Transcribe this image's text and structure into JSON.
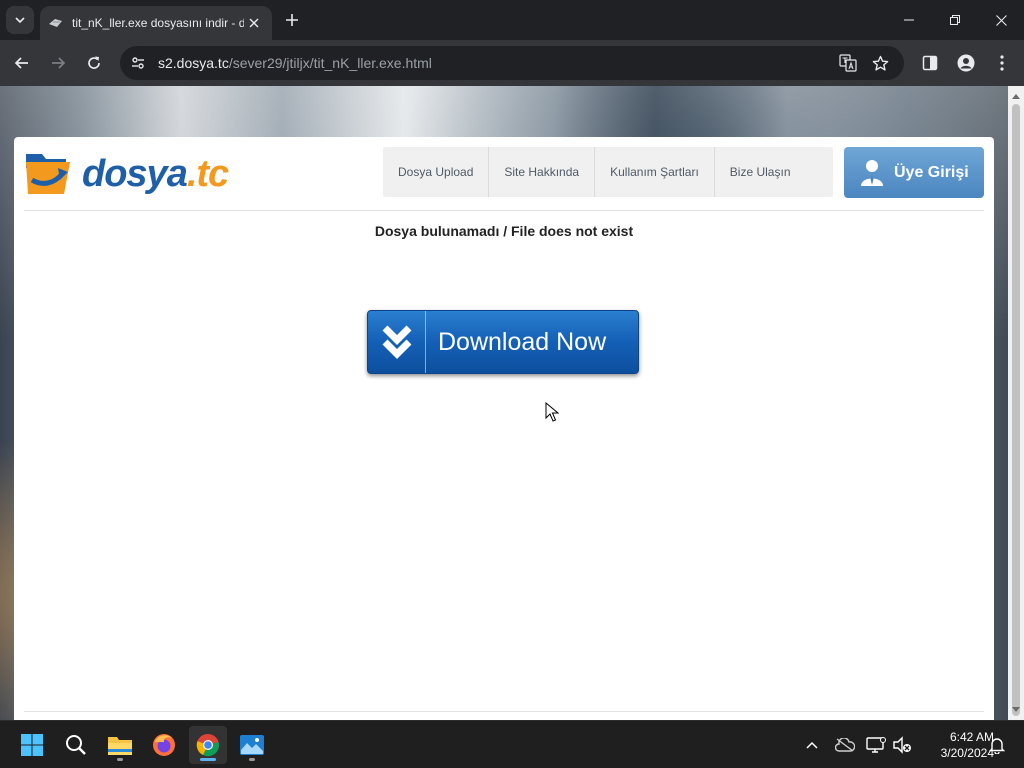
{
  "browser": {
    "tab_title": "tit_nK_ller.exe dosyasını indir - d",
    "url_host": "s2.dosya.tc",
    "url_path": "/sever29/jtiljx/tit_nK_ller.exe.html"
  },
  "site": {
    "logo_main": "dosya",
    "logo_accent": ".tc",
    "nav": [
      "Dosya Upload",
      "Site Hakkında",
      "Kullanım Şartları",
      "Bize Ulaşın"
    ],
    "login_label": "Üye Girişi",
    "notice": "Dosya bulunamadı / File does not exist",
    "download_label": "Download Now",
    "colors": {
      "logo_blue": "#1f5fa8",
      "logo_orange": "#f39a1e",
      "download_blue": "#1460b6",
      "login_blue": "#5a94c9"
    }
  },
  "taskbar": {
    "apps": [
      "start-icon",
      "search-icon",
      "file-explorer-icon",
      "firefox-icon",
      "chrome-icon",
      "photos-icon"
    ],
    "time": "6:42 AM",
    "date": "3/20/2024"
  }
}
